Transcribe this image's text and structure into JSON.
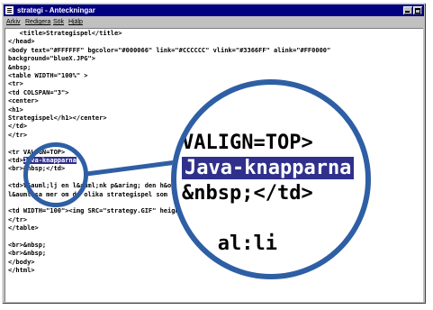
{
  "window": {
    "title": "strategi - Anteckningar"
  },
  "menu": [
    "Arkiv",
    "Redigera",
    "Sök",
    "Hjälp"
  ],
  "code_lines": [
    {
      "text": "   <title>Strategispel</title>"
    },
    {
      "text": "</head>"
    },
    {
      "text": "<body text=\"#FFFFFF\" bgcolor=\"#000066\" link=\"#CCCCCC\" vlink=\"#3366FF\" alink=\"#FF0000\""
    },
    {
      "text": "background=\"blueX.JPG\">"
    },
    {
      "text": "&nbsp;"
    },
    {
      "text": "<table WIDTH=\"100%\" >"
    },
    {
      "text": "<tr>"
    },
    {
      "text": "<td COLSPAN=\"3\">"
    },
    {
      "text": "<center>"
    },
    {
      "text": "<h1>"
    },
    {
      "text": "Strategispel</h1></center>"
    },
    {
      "text": "</td>"
    },
    {
      "text": "</tr>"
    },
    {
      "text": ""
    },
    {
      "text": "<tr VALIGN=TOP>"
    },
    {
      "pre": "<td>",
      "sel": "Java-knapparna",
      "post": ""
    },
    {
      "text": "<br>&nbsp;</td>"
    },
    {
      "text": ""
    },
    {
      "text": "<td>V&auml;lj en l&auml;nk p&aring; den h&ouml;gra sidan f&ouml;r att"
    },
    {
      "text": "l&auml;sa mer om de olika strategispel som finns</td>"
    },
    {
      "text": ""
    },
    {
      "text": "<td WIDTH=\"100\"><img SRC=\"strategy.GIF\" height=\"100\"></td>"
    },
    {
      "text": "</tr>"
    },
    {
      "text": "</table>"
    },
    {
      "text": ""
    },
    {
      "text": "<br>&nbsp;"
    },
    {
      "text": "<br>&nbsp;"
    },
    {
      "text": "</body>"
    },
    {
      "text": "</html>"
    }
  ],
  "magnified_lines": [
    {
      "text": "VALIGN=TOP>"
    },
    {
      "sel": "Java-knapparna"
    },
    {
      "text": "&nbsp;</td>"
    },
    {
      "text": ""
    },
    {
      "text": "   al:li"
    }
  ],
  "accent_colors": {
    "selection": "#30308c",
    "callout": "#2e5fa5",
    "titlebar": "#000080"
  }
}
